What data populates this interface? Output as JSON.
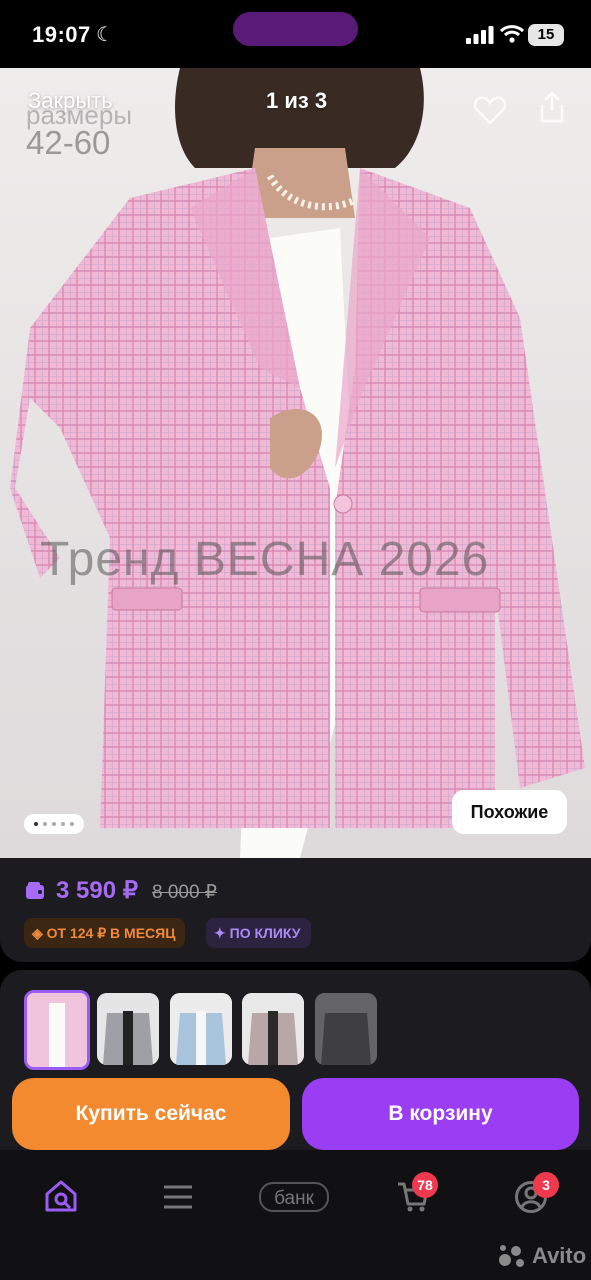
{
  "status_bar": {
    "time": "19:07",
    "battery": "15"
  },
  "viewer": {
    "close_label": "Закрыть",
    "counter": "1 из 3"
  },
  "photo": {
    "sizes_label": "размеры",
    "sizes_value": "42-60",
    "watermark": "Тренд ВЕСНА 2026",
    "similar_label": "Похожие"
  },
  "pricing": {
    "price": "3 590 ₽",
    "old_price": "8 000 ₽",
    "installment": "ОТ 124 ₽ В МЕСЯЦ",
    "quick_buy": "ПО КЛИКУ"
  },
  "actions": {
    "buy_now": "Купить сейчас",
    "add_to_cart": "В корзину"
  },
  "nav": {
    "bank_label": "банк",
    "cart_badge": "78",
    "profile_badge": "3",
    "brand": "Avito"
  },
  "colors": {
    "accent_purple": "#9b3df2",
    "accent_orange": "#f38a2f",
    "price_purple": "#a66bf5"
  }
}
